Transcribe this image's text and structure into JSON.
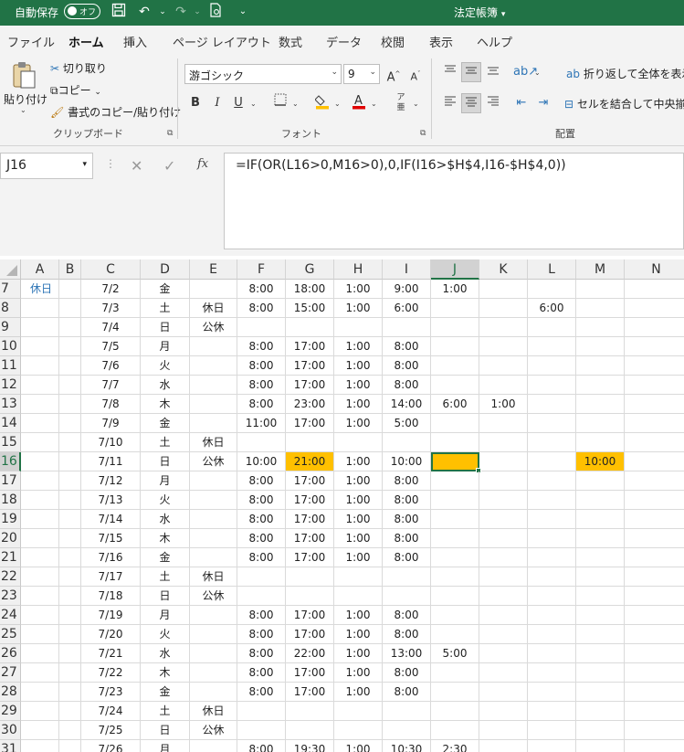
{
  "titlebar": {
    "autosave_label": "自動保存",
    "autosave_state": "オフ",
    "doc_title": "法定帳簿"
  },
  "tabs": [
    "ファイル",
    "ホーム",
    "挿入",
    "ページ レイアウト",
    "数式",
    "データ",
    "校閲",
    "表示",
    "ヘルプ"
  ],
  "active_tab": "ホーム",
  "ribbon": {
    "clipboard": {
      "paste": "貼り付け",
      "cut": "切り取り",
      "copy": "コピー",
      "format_painter": "書式のコピー/貼り付け",
      "group": "クリップボード"
    },
    "font": {
      "name": "游ゴシック",
      "size": "9",
      "group": "フォント"
    },
    "alignment": {
      "wrap": "折り返して全体を表示す",
      "merge": "セルを結合して中央揃え",
      "group": "配置"
    }
  },
  "formula_bar": {
    "name_box": "J16",
    "formula": "=IF(OR(L16>0,M16>0),0,IF(I16>$H$4,I16-$H$4,0))"
  },
  "sheet": {
    "columns": [
      "A",
      "B",
      "C",
      "D",
      "E",
      "F",
      "G",
      "H",
      "I",
      "J",
      "K",
      "L",
      "M",
      "N"
    ],
    "active_column": "J",
    "active_row": "16",
    "rows": [
      {
        "n": "7",
        "A": "休日",
        "C": "7/2",
        "D": "金",
        "E": "",
        "F": "8:00",
        "G": "18:00",
        "H": "1:00",
        "I": "9:00",
        "J": "1:00",
        "K": "",
        "L": "",
        "M": ""
      },
      {
        "n": "8",
        "A": "",
        "C": "7/3",
        "D": "土",
        "E": "休日",
        "F": "8:00",
        "G": "15:00",
        "H": "1:00",
        "I": "6:00",
        "J": "",
        "K": "",
        "L": "6:00",
        "M": ""
      },
      {
        "n": "9",
        "A": "",
        "C": "7/4",
        "D": "日",
        "E": "公休",
        "F": "",
        "G": "",
        "H": "",
        "I": "",
        "J": "",
        "K": "",
        "L": "",
        "M": ""
      },
      {
        "n": "10",
        "A": "",
        "C": "7/5",
        "D": "月",
        "E": "",
        "F": "8:00",
        "G": "17:00",
        "H": "1:00",
        "I": "8:00",
        "J": "",
        "K": "",
        "L": "",
        "M": ""
      },
      {
        "n": "11",
        "A": "",
        "C": "7/6",
        "D": "火",
        "E": "",
        "F": "8:00",
        "G": "17:00",
        "H": "1:00",
        "I": "8:00",
        "J": "",
        "K": "",
        "L": "",
        "M": ""
      },
      {
        "n": "12",
        "A": "",
        "C": "7/7",
        "D": "水",
        "E": "",
        "F": "8:00",
        "G": "17:00",
        "H": "1:00",
        "I": "8:00",
        "J": "",
        "K": "",
        "L": "",
        "M": ""
      },
      {
        "n": "13",
        "A": "",
        "C": "7/8",
        "D": "木",
        "E": "",
        "F": "8:00",
        "G": "23:00",
        "H": "1:00",
        "I": "14:00",
        "J": "6:00",
        "K": "1:00",
        "L": "",
        "M": ""
      },
      {
        "n": "14",
        "A": "",
        "C": "7/9",
        "D": "金",
        "E": "",
        "F": "11:00",
        "G": "17:00",
        "H": "1:00",
        "I": "5:00",
        "J": "",
        "K": "",
        "L": "",
        "M": ""
      },
      {
        "n": "15",
        "A": "",
        "C": "7/10",
        "D": "土",
        "E": "休日",
        "F": "",
        "G": "",
        "H": "",
        "I": "",
        "J": "",
        "K": "",
        "L": "",
        "M": ""
      },
      {
        "n": "16",
        "A": "",
        "C": "7/11",
        "D": "日",
        "E": "公休",
        "F": "10:00",
        "G": "21:00",
        "H": "1:00",
        "I": "10:00",
        "J": "",
        "K": "",
        "L": "",
        "M": "10:00"
      },
      {
        "n": "17",
        "A": "",
        "C": "7/12",
        "D": "月",
        "E": "",
        "F": "8:00",
        "G": "17:00",
        "H": "1:00",
        "I": "8:00",
        "J": "",
        "K": "",
        "L": "",
        "M": ""
      },
      {
        "n": "18",
        "A": "",
        "C": "7/13",
        "D": "火",
        "E": "",
        "F": "8:00",
        "G": "17:00",
        "H": "1:00",
        "I": "8:00",
        "J": "",
        "K": "",
        "L": "",
        "M": ""
      },
      {
        "n": "19",
        "A": "",
        "C": "7/14",
        "D": "水",
        "E": "",
        "F": "8:00",
        "G": "17:00",
        "H": "1:00",
        "I": "8:00",
        "J": "",
        "K": "",
        "L": "",
        "M": ""
      },
      {
        "n": "20",
        "A": "",
        "C": "7/15",
        "D": "木",
        "E": "",
        "F": "8:00",
        "G": "17:00",
        "H": "1:00",
        "I": "8:00",
        "J": "",
        "K": "",
        "L": "",
        "M": ""
      },
      {
        "n": "21",
        "A": "",
        "C": "7/16",
        "D": "金",
        "E": "",
        "F": "8:00",
        "G": "17:00",
        "H": "1:00",
        "I": "8:00",
        "J": "",
        "K": "",
        "L": "",
        "M": ""
      },
      {
        "n": "22",
        "A": "",
        "C": "7/17",
        "D": "土",
        "E": "休日",
        "F": "",
        "G": "",
        "H": "",
        "I": "",
        "J": "",
        "K": "",
        "L": "",
        "M": ""
      },
      {
        "n": "23",
        "A": "",
        "C": "7/18",
        "D": "日",
        "E": "公休",
        "F": "",
        "G": "",
        "H": "",
        "I": "",
        "J": "",
        "K": "",
        "L": "",
        "M": ""
      },
      {
        "n": "24",
        "A": "",
        "C": "7/19",
        "D": "月",
        "E": "",
        "F": "8:00",
        "G": "17:00",
        "H": "1:00",
        "I": "8:00",
        "J": "",
        "K": "",
        "L": "",
        "M": ""
      },
      {
        "n": "25",
        "A": "",
        "C": "7/20",
        "D": "火",
        "E": "",
        "F": "8:00",
        "G": "17:00",
        "H": "1:00",
        "I": "8:00",
        "J": "",
        "K": "",
        "L": "",
        "M": ""
      },
      {
        "n": "26",
        "A": "",
        "C": "7/21",
        "D": "水",
        "E": "",
        "F": "8:00",
        "G": "22:00",
        "H": "1:00",
        "I": "13:00",
        "J": "5:00",
        "K": "",
        "L": "",
        "M": ""
      },
      {
        "n": "27",
        "A": "",
        "C": "7/22",
        "D": "木",
        "E": "",
        "F": "8:00",
        "G": "17:00",
        "H": "1:00",
        "I": "8:00",
        "J": "",
        "K": "",
        "L": "",
        "M": ""
      },
      {
        "n": "28",
        "A": "",
        "C": "7/23",
        "D": "金",
        "E": "",
        "F": "8:00",
        "G": "17:00",
        "H": "1:00",
        "I": "8:00",
        "J": "",
        "K": "",
        "L": "",
        "M": ""
      },
      {
        "n": "29",
        "A": "",
        "C": "7/24",
        "D": "土",
        "E": "休日",
        "F": "",
        "G": "",
        "H": "",
        "I": "",
        "J": "",
        "K": "",
        "L": "",
        "M": ""
      },
      {
        "n": "30",
        "A": "",
        "C": "7/25",
        "D": "日",
        "E": "公休",
        "F": "",
        "G": "",
        "H": "",
        "I": "",
        "J": "",
        "K": "",
        "L": "",
        "M": ""
      },
      {
        "n": "31",
        "A": "",
        "C": "7/26",
        "D": "月",
        "E": "",
        "F": "8:00",
        "G": "19:30",
        "H": "1:00",
        "I": "10:30",
        "J": "2:30",
        "K": "",
        "L": "",
        "M": ""
      }
    ],
    "highlighted_cells": [
      "G16",
      "J16",
      "M16"
    ],
    "colors": {
      "highlight": "#ffc000",
      "accent": "#217346"
    }
  }
}
